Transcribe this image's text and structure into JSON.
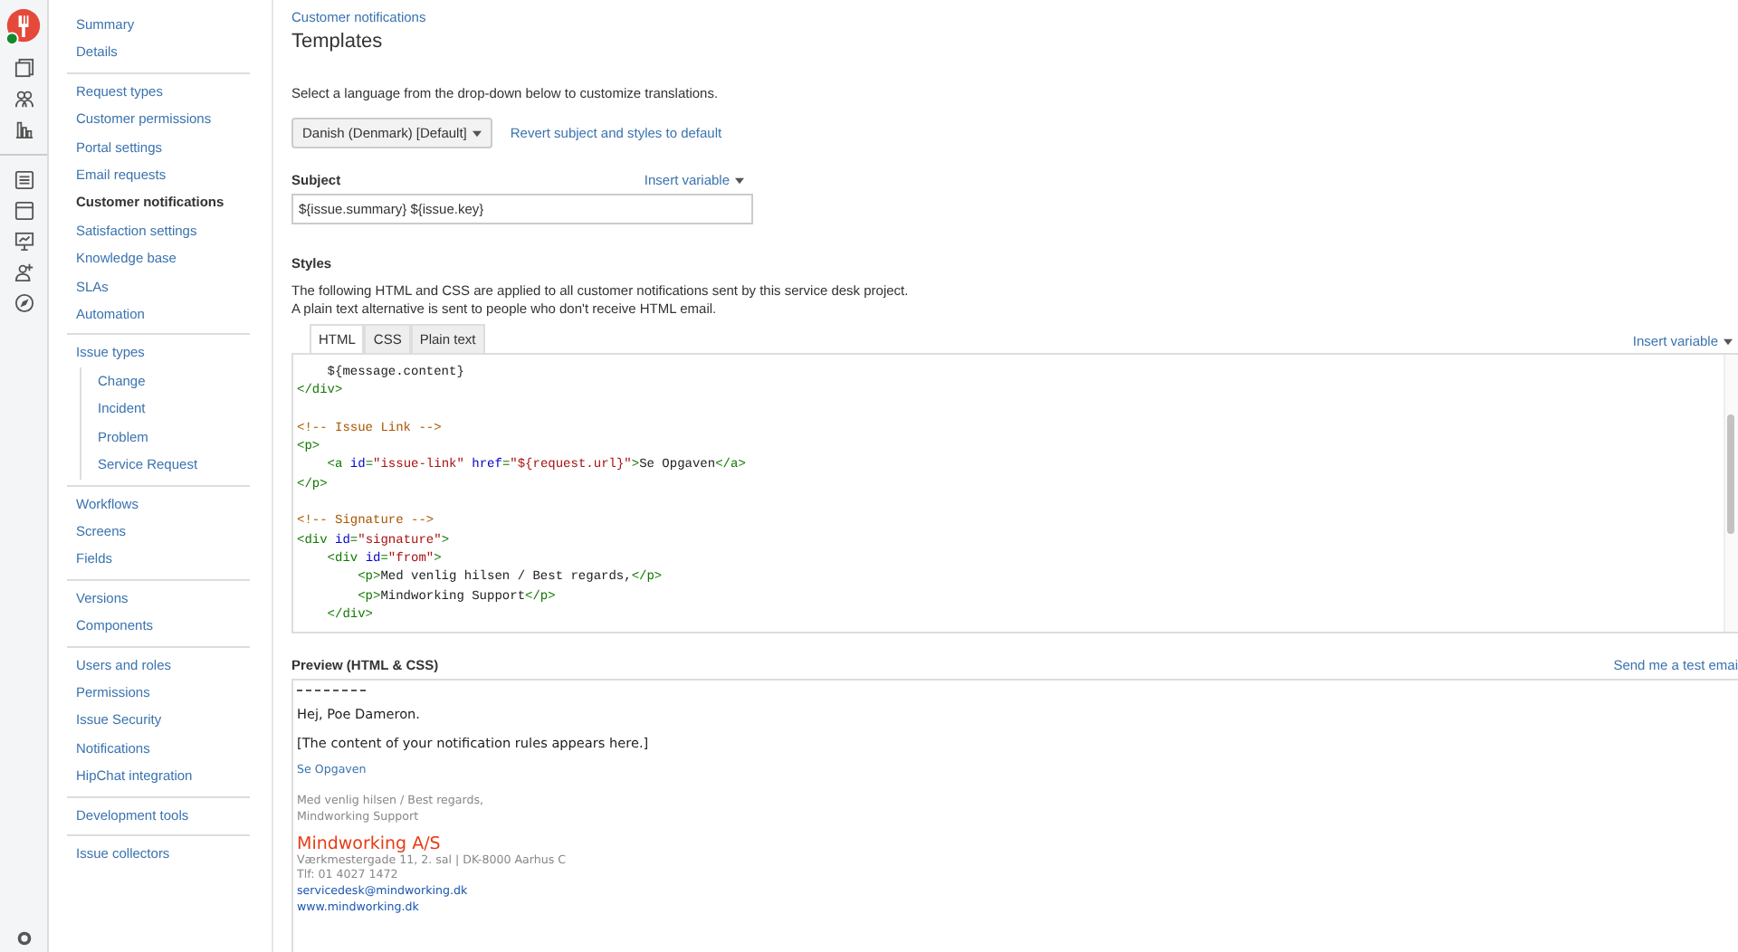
{
  "sidebar": {
    "groups": [
      {
        "items": [
          {
            "label": "Summary",
            "selected": false
          },
          {
            "label": "Details",
            "selected": false
          }
        ]
      },
      {
        "items": [
          {
            "label": "Request types",
            "selected": false
          },
          {
            "label": "Customer permissions",
            "selected": false
          },
          {
            "label": "Portal settings",
            "selected": false
          },
          {
            "label": "Email requests",
            "selected": false
          },
          {
            "label": "Customer notifications",
            "selected": true
          },
          {
            "label": "Satisfaction settings",
            "selected": false
          },
          {
            "label": "Knowledge base",
            "selected": false
          },
          {
            "label": "SLAs",
            "selected": false
          },
          {
            "label": "Automation",
            "selected": false
          }
        ]
      },
      {
        "items": [
          {
            "label": "Issue types",
            "selected": false,
            "children": [
              {
                "label": "Change",
                "selected": false
              },
              {
                "label": "Incident",
                "selected": false
              },
              {
                "label": "Problem",
                "selected": false
              },
              {
                "label": "Service Request",
                "selected": false
              }
            ]
          }
        ]
      },
      {
        "items": [
          {
            "label": "Workflows",
            "selected": false
          },
          {
            "label": "Screens",
            "selected": false
          },
          {
            "label": "Fields",
            "selected": false
          }
        ]
      },
      {
        "items": [
          {
            "label": "Versions",
            "selected": false
          },
          {
            "label": "Components",
            "selected": false
          }
        ]
      },
      {
        "items": [
          {
            "label": "Users and roles",
            "selected": false
          },
          {
            "label": "Permissions",
            "selected": false
          },
          {
            "label": "Issue Security",
            "selected": false
          },
          {
            "label": "Notifications",
            "selected": false
          },
          {
            "label": "HipChat integration",
            "selected": false
          }
        ]
      },
      {
        "items": [
          {
            "label": "Development tools",
            "selected": false
          }
        ]
      },
      {
        "items": [
          {
            "label": "Issue collectors",
            "selected": false
          }
        ]
      }
    ]
  },
  "breadcrumb": "Customer notifications",
  "title": "Templates",
  "intro": "Select a language from the drop-down below to customize translations.",
  "language_select": "Danish (Denmark) [Default]",
  "revert_link": "Revert subject and styles to default",
  "subject": {
    "label": "Subject",
    "insert_variable": "Insert variable",
    "value": "${issue.summary} ${issue.key}"
  },
  "styles": {
    "label": "Styles",
    "description": [
      "The following HTML and CSS are applied to all customer notifications sent by this service desk project.",
      "A plain text alternative is sent to people who don't receive HTML email."
    ],
    "tabs": [
      {
        "label": "HTML",
        "selected": true
      },
      {
        "label": "CSS",
        "selected": false
      },
      {
        "label": "Plain text",
        "selected": false
      }
    ],
    "insert_variable": "Insert variable",
    "code_lines": [
      {
        "kind": "indented",
        "tokens": [
          {
            "kind": "text",
            "text": "${message.content}"
          }
        ]
      },
      {
        "kind": "flush",
        "tokens": [
          {
            "kind": "tag",
            "text": "</div>"
          }
        ]
      },
      {
        "kind": "blank"
      },
      {
        "kind": "flush",
        "tokens": [
          {
            "kind": "comment",
            "text": "<!-- Issue Link -->"
          }
        ]
      },
      {
        "kind": "flush",
        "tokens": [
          {
            "kind": "tag",
            "text": "<p>"
          }
        ]
      },
      {
        "kind": "indented",
        "tokens": [
          {
            "kind": "tag",
            "text": "<a "
          },
          {
            "kind": "attr",
            "text": "id"
          },
          {
            "kind": "tag",
            "text": "="
          },
          {
            "kind": "string",
            "text": "\"issue-link\""
          },
          {
            "kind": "attr",
            "text": " href"
          },
          {
            "kind": "tag",
            "text": "="
          },
          {
            "kind": "string",
            "text": "\"${request.url}\""
          },
          {
            "kind": "tag",
            "text": ">"
          },
          {
            "kind": "text",
            "text": "Se Opgaven"
          },
          {
            "kind": "tag",
            "text": "</a>"
          }
        ]
      },
      {
        "kind": "flush",
        "tokens": [
          {
            "kind": "tag",
            "text": "</p>"
          }
        ]
      },
      {
        "kind": "blank"
      },
      {
        "kind": "flush",
        "tokens": [
          {
            "kind": "comment",
            "text": "<!-- Signature -->"
          }
        ]
      },
      {
        "kind": "flush",
        "tokens": [
          {
            "kind": "tag",
            "text": "<div "
          },
          {
            "kind": "attr",
            "text": "id"
          },
          {
            "kind": "tag",
            "text": "="
          },
          {
            "kind": "string",
            "text": "\"signature\""
          },
          {
            "kind": "tag",
            "text": ">"
          }
        ]
      },
      {
        "kind": "indented",
        "tokens": [
          {
            "kind": "tag",
            "text": "<div "
          },
          {
            "kind": "attr",
            "text": "id"
          },
          {
            "kind": "tag",
            "text": "="
          },
          {
            "kind": "string",
            "text": "\"from\""
          },
          {
            "kind": "tag",
            "text": ">"
          }
        ]
      },
      {
        "kind": "double_indented",
        "tokens": [
          {
            "kind": "tag",
            "text": "<p>"
          },
          {
            "kind": "text",
            "text": "Med venlig hilsen / Best regards,"
          },
          {
            "kind": "tag",
            "text": "</p>"
          }
        ]
      },
      {
        "kind": "double_indented",
        "tokens": [
          {
            "kind": "tag",
            "text": "<p>"
          },
          {
            "kind": "text",
            "text": "Mindworking Support"
          },
          {
            "kind": "tag",
            "text": "</p>"
          }
        ]
      },
      {
        "kind": "indented",
        "tokens": [
          {
            "kind": "tag",
            "text": "</div>"
          }
        ]
      }
    ]
  },
  "preview": {
    "label": "Preview (HTML & CSS)",
    "send_test": "Send me a test emai",
    "greeting": "Hej, Poe Dameron.",
    "content": "[The content of your notification rules appears here.]",
    "issue_link": "Se Opgaven",
    "signature": [
      "Med venlig hilsen / Best regards,",
      "Mindworking Support"
    ],
    "company": "Mindworking A/S",
    "address": [
      "Værkmestergade 11, 2. sal | DK-8000 Aarhus C",
      "Tlf: 01 4027 1472"
    ],
    "links": [
      "servicedesk@mindworking.dk",
      "www.mindworking.dk"
    ]
  }
}
